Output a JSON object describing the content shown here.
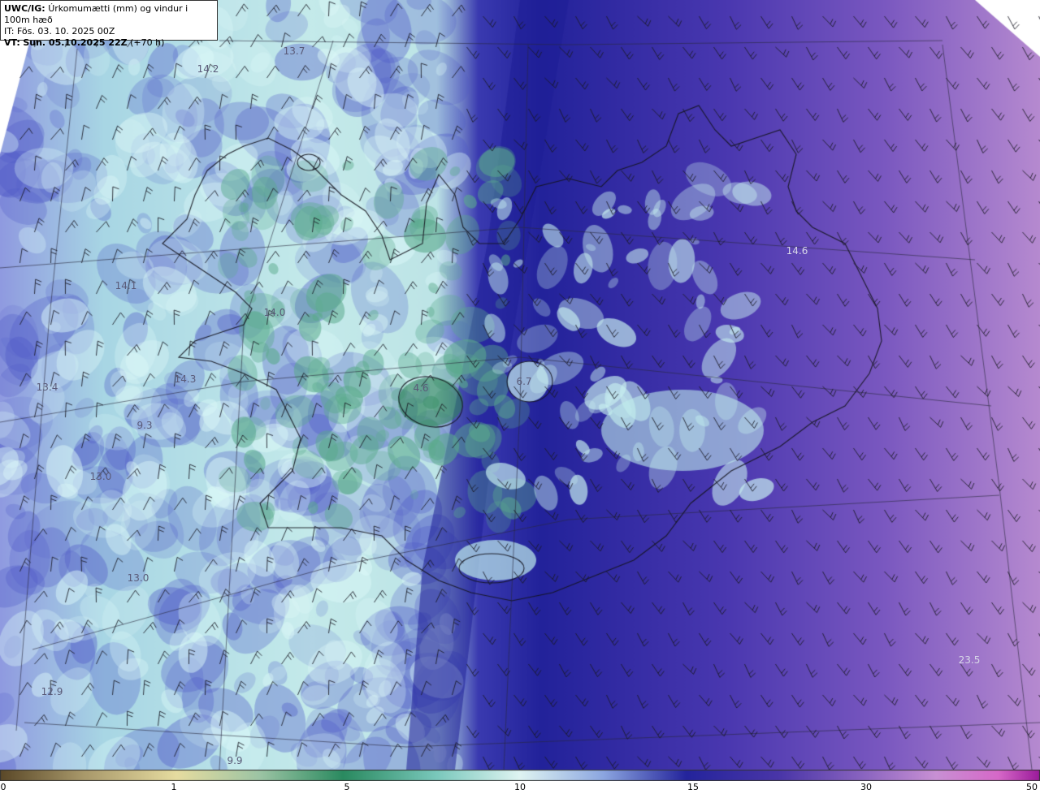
{
  "header": {
    "line1_prefix": "UWC/IG:",
    "line1_text": "Úrkomumætti (mm) og vindur i 100m hæð",
    "line2": "IT: Fös. 03. 10. 2025 00Z",
    "line3_prefix": "VT:",
    "line3_text": "Sun. 05.10.2025 22Z",
    "line3_suffix": "(+70 h)"
  },
  "map_labels": [
    "13.7",
    "14.2",
    "14.6",
    "14.1",
    "14.0",
    "14.3",
    "13.4",
    "6.7",
    "4.6",
    "9.3",
    "13.0",
    "13.0",
    "12.9",
    "23.5",
    "9.9"
  ],
  "colorbar": {
    "ticks": [
      "0",
      "1",
      "5",
      "10",
      "15",
      "30",
      "50"
    ],
    "colors": [
      "#5c4a2a",
      "#c8b680",
      "#e8e0a0",
      "#2e8a5a",
      "#a8e0d8",
      "#e0f4f4",
      "#5a6ad0",
      "#202070",
      "#5a3aa0",
      "#b07ac8",
      "#d070c8",
      "#a020a0"
    ]
  }
}
